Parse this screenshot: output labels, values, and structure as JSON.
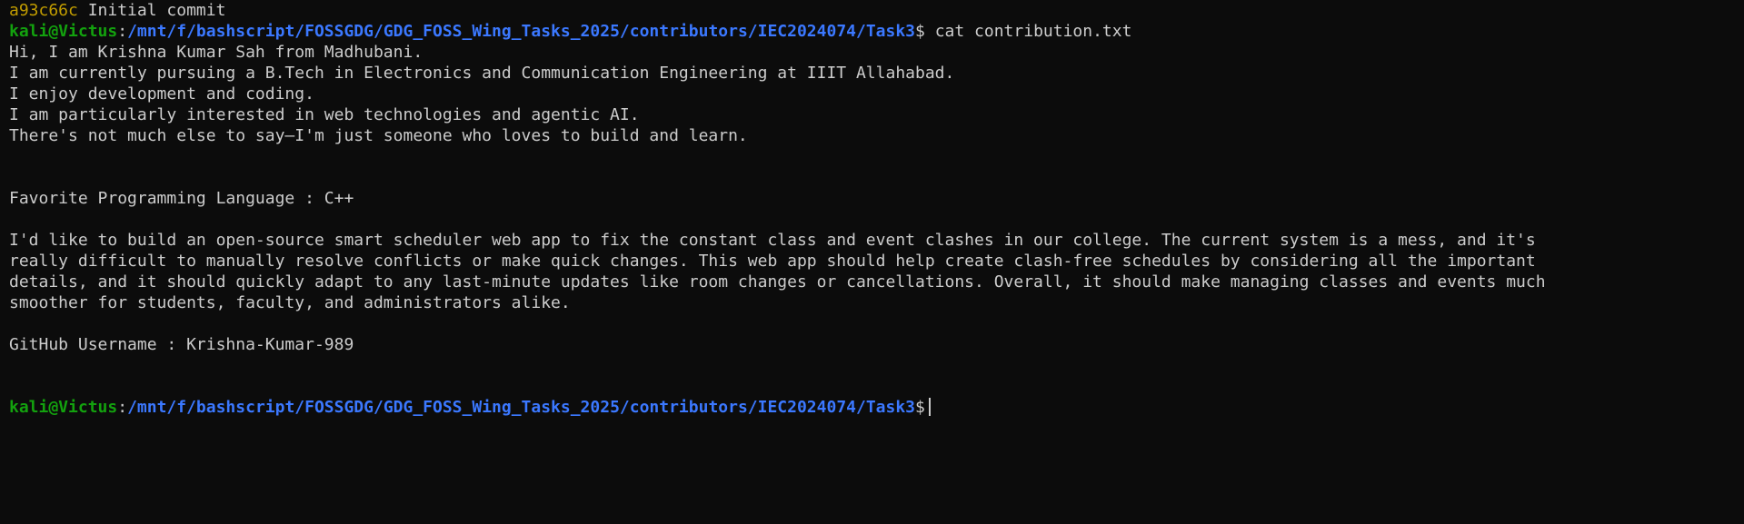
{
  "commit": {
    "hash": "a93c66c",
    "message": "Initial commit"
  },
  "prompt": {
    "user_host": "kali@Victus",
    "separator": ":",
    "path": "/mnt/f/bashscript/FOSSGDG/GDG_FOSS_Wing_Tasks_2025/contributors/IEC2024074/Task3",
    "symbol": "$"
  },
  "command": "cat contribution.txt",
  "output": {
    "intro": [
      "Hi, I am Krishna Kumar Sah from Madhubani.",
      "I am currently pursuing a B.Tech in Electronics and Communication Engineering at IIIT Allahabad.",
      "I enjoy development and coding.",
      "I am particularly interested in web technologies and agentic AI.",
      "There's not much else to say—I'm just someone who loves to build and learn."
    ],
    "favorite_language": "Favorite Programming Language : C++",
    "idea": [
      "I'd like to build an open-source smart scheduler web app to fix the constant class and event clashes in our college. The current system is a mess, and it's",
      "really difficult to manually resolve conflicts or make quick changes. This web app should help create clash-free schedules by considering all the important",
      "details, and it should quickly adapt to any last-minute updates like room changes or cancellations. Overall, it should make managing classes and events much",
      "smoother for students, faculty, and administrators alike."
    ],
    "github": "GitHub Username : Krishna-Kumar-989"
  },
  "colors": {
    "background": "#0c0c0c",
    "foreground": "#cccccc",
    "user_host": "#13a10e",
    "path": "#3b78ff",
    "commit_hash": "#c19c00"
  }
}
